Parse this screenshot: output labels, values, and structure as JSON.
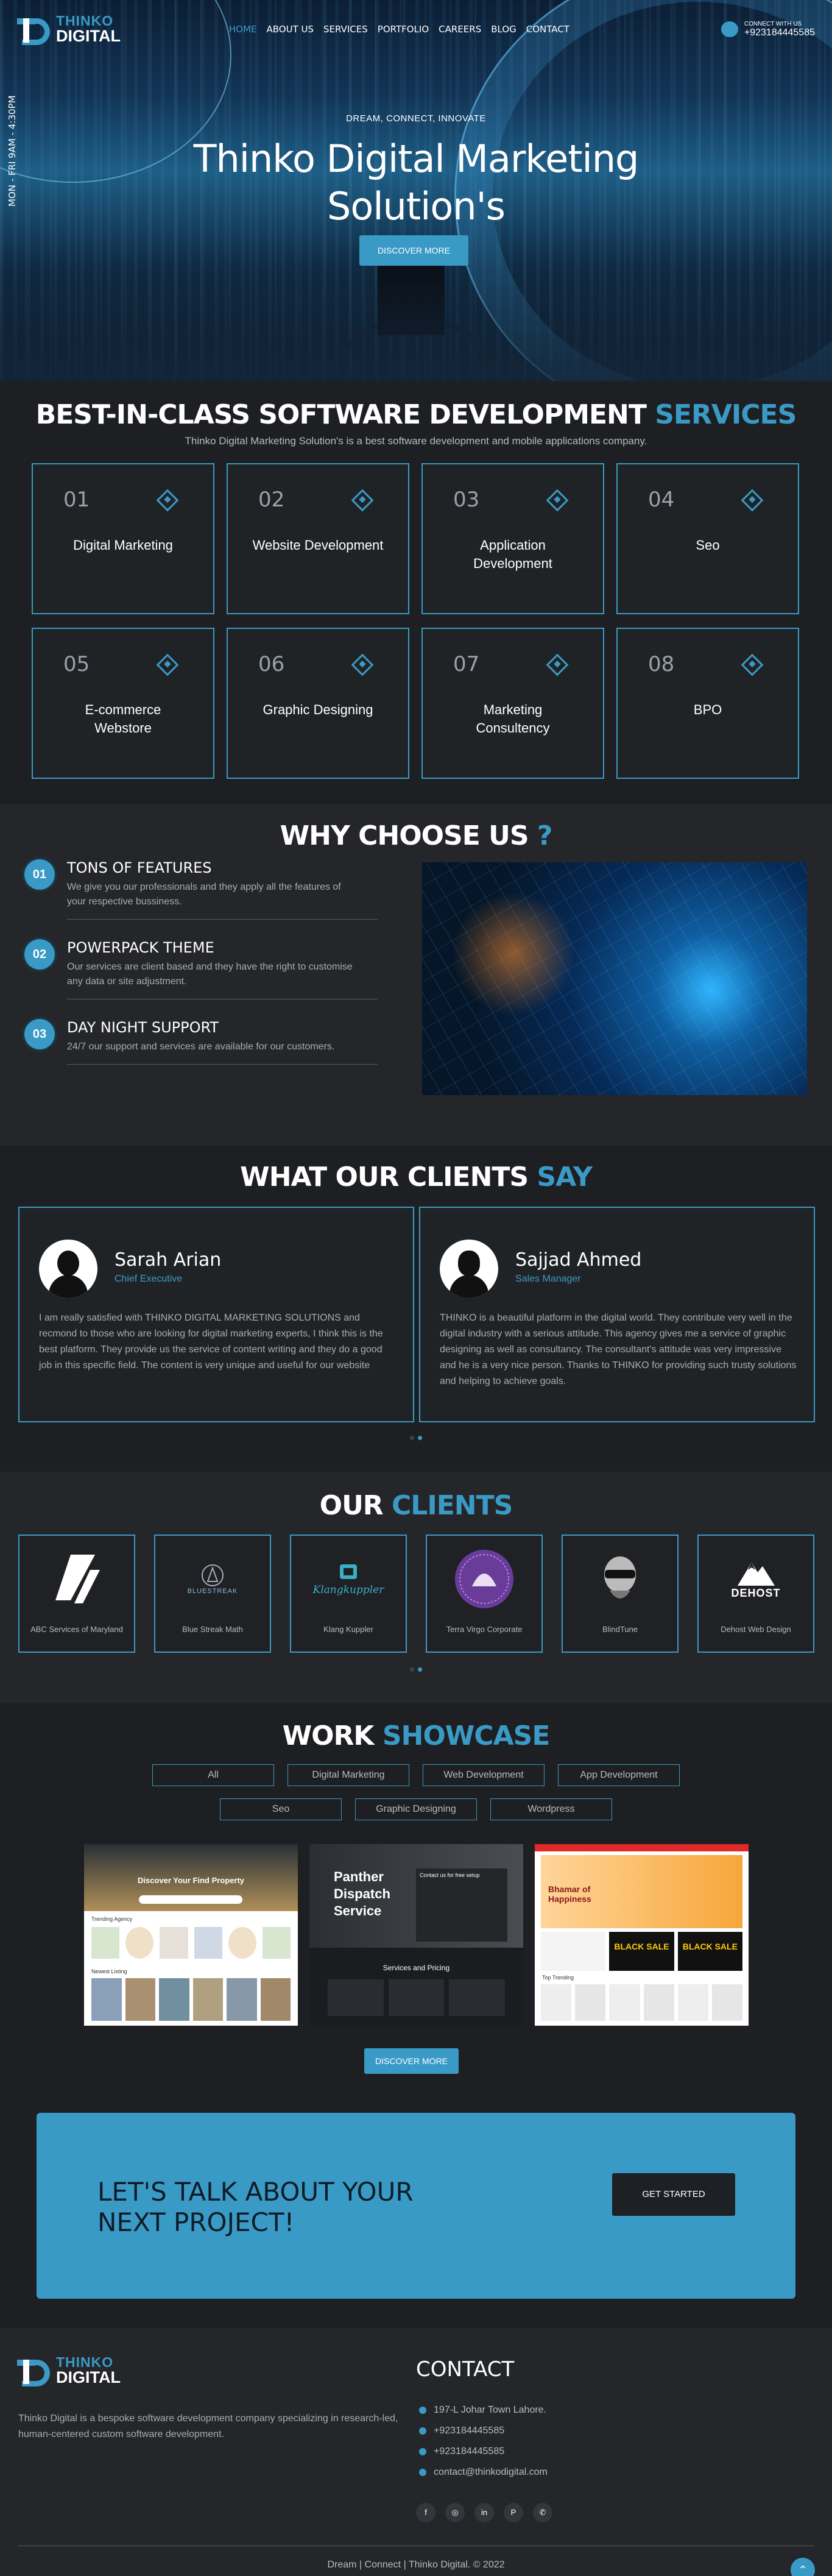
{
  "brand": {
    "line1": "THINKO",
    "line2": "DIGITAL"
  },
  "nav": {
    "items": [
      "HOME",
      "ABOUT US",
      "SERVICES",
      "PORTFOLIO",
      "CAREERS",
      "BLOG",
      "CONTACT"
    ],
    "connect_label": "CONNECT WITH US",
    "phone": "+923184445585"
  },
  "hero": {
    "hours": "MON - FRI  9AM - 4:30PM",
    "tagline": "DREAM, CONNECT, INNOVATE",
    "title": "Thinko Digital Marketing Solution's",
    "button": "DISCOVER MORE"
  },
  "services": {
    "title_main": "BEST-IN-CLASS SOFTWARE DEVELOPMENT ",
    "title_accent": "SERVICES",
    "subtitle": "Thinko Digital Marketing Solution's is a best software development and mobile applications company.",
    "items": [
      {
        "num": "01",
        "label": "Digital Marketing"
      },
      {
        "num": "02",
        "label": "Website Development"
      },
      {
        "num": "03",
        "label": "Application Development"
      },
      {
        "num": "04",
        "label": "Seo"
      },
      {
        "num": "05",
        "label": "E-commerce Webstore"
      },
      {
        "num": "06",
        "label": "Graphic Designing"
      },
      {
        "num": "07",
        "label": "Marketing Consultency"
      },
      {
        "num": "08",
        "label": "BPO"
      }
    ]
  },
  "why": {
    "title_main": "WHY CHOOSE US ",
    "title_accent": "?",
    "items": [
      {
        "num": "01",
        "title": "TONS OF FEATURES",
        "text": "We give you our professionals and they apply all the features of your respective bussiness."
      },
      {
        "num": "02",
        "title": "POWERPACK THEME",
        "text": "Our services are client based and they have the right to customise any data or site adjustment."
      },
      {
        "num": "03",
        "title": "DAY NIGHT SUPPORT",
        "text": "24/7 our support and services are available for our customers."
      }
    ]
  },
  "testimonials": {
    "title_main": "WHAT OUR CLIENTS ",
    "title_accent": "SAY",
    "items": [
      {
        "name": "Sarah Arian",
        "role": "Chief Executive",
        "text": "I am really satisfied with THINKO DIGITAL MARKETING SOLUTIONS and recmond to those who are looking for digital marketing experts, I think this is the best platform. They provide us the service of content writing and they do a good job in this specific field. The content is very unique and useful for our website"
      },
      {
        "name": "Sajjad Ahmed",
        "role": "Sales Manager",
        "text": "THINKO is a beautiful platform in the digital world. They contribute very well in the digital industry with a serious attitude. This agency gives me a service of graphic designing as well as consultancy. The consultant's attitude was very impressive and he is a very nice person. Thanks to THINKO for providing such trusty solutions and helping to achieve goals."
      }
    ]
  },
  "clients": {
    "title_main": "OUR ",
    "title_accent": "CLIENTS",
    "items": [
      {
        "name": "ABC Services of Maryland",
        "logo_text": ""
      },
      {
        "name": "Blue Streak Math",
        "logo_text": "BLUESTREAK"
      },
      {
        "name": "Klang Kuppler",
        "logo_text": "Klangkuppler"
      },
      {
        "name": "Terra Virgo Corporate",
        "logo_text": ""
      },
      {
        "name": "BlindTune",
        "logo_text": ""
      },
      {
        "name": "Dehost Web Design",
        "logo_text": "DEHOST"
      }
    ]
  },
  "showcase": {
    "title_main": "WORK ",
    "title_accent": "SHOWCASE",
    "filters": [
      "All",
      "Digital Marketing",
      "Web Development",
      "App Development",
      "Seo",
      "Graphic Designing",
      "Wordpress"
    ],
    "shot1": {
      "title": "Discover Your Find Property",
      "section": "Trending Agency",
      "section2": "Newest Listing"
    },
    "shot2": {
      "title": "Panther Dispatch Service",
      "form": "Contact us for free setup",
      "section": "Services and Pricing"
    },
    "shot3": {
      "title": "Bhamar of Happiness",
      "promo": "BLACK SALE",
      "section": "Top Trending"
    },
    "button": "DISCOVER MORE"
  },
  "cta": {
    "title": "LET'S TALK ABOUT YOUR NEXT PROJECT!",
    "button": "GET STARTED"
  },
  "footer": {
    "about": "Thinko Digital is a bespoke software development company specializing in research-led, human-centered custom software development.",
    "contact_title": "CONTACT",
    "contacts": [
      "197-L Johar Town Lahore.",
      "+923184445585",
      "+923184445585",
      "contact@thinkodigital.com"
    ],
    "social_icons": [
      "facebook-icon",
      "instagram-icon",
      "linkedin-icon",
      "pinterest-icon",
      "whatsapp-icon"
    ],
    "copyright": "Dream | Connect | Thinko Digital. © 2022"
  },
  "colors": {
    "accent": "#3a9ac6",
    "background": "#1d1f22",
    "panel": "#252629"
  }
}
